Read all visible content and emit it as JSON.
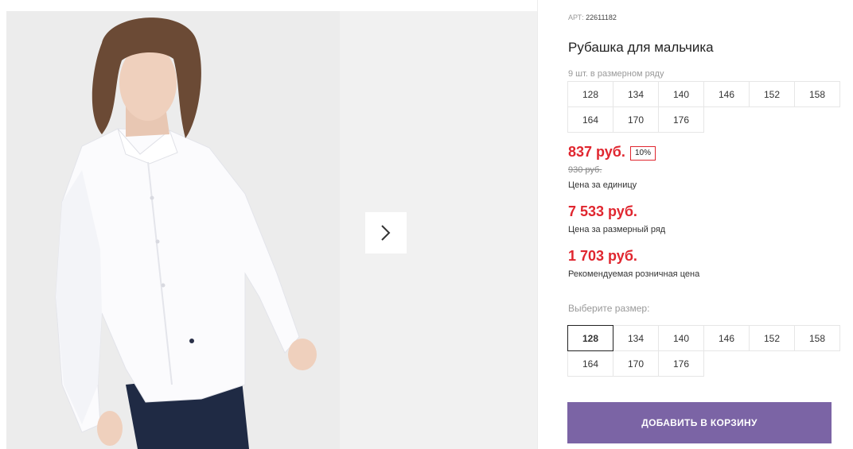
{
  "gallery": {
    "photo_alt": "Рубашка для мальчика",
    "next_icon": "chevron-right-icon"
  },
  "product": {
    "art_label": "АРТ:",
    "art_number": "22611182",
    "title": "Рубашка для мальчика",
    "row_note": "9 шт. в размерном ряду",
    "row_sizes": [
      "128",
      "134",
      "140",
      "146",
      "152",
      "158",
      "164",
      "170",
      "176"
    ]
  },
  "pricing": {
    "unit_price": "837 руб.",
    "discount_badge": "10%",
    "old_price": "930 руб.",
    "unit_caption": "Цена за единицу",
    "row_price": "7 533 руб.",
    "row_caption": "Цена за размерный ряд",
    "retail_price": "1 703 руб.",
    "retail_caption": "Рекомендуемая розничная цена"
  },
  "size_select": {
    "label": "Выберите размер:",
    "selected": "128",
    "options": [
      "128",
      "134",
      "140",
      "146",
      "152",
      "158",
      "164",
      "170",
      "176"
    ]
  },
  "cart": {
    "add_button": "ДОБАВИТЬ В КОРЗИНУ"
  },
  "colors": {
    "price_red": "#e0262f",
    "button_purple": "#7b64a5"
  }
}
